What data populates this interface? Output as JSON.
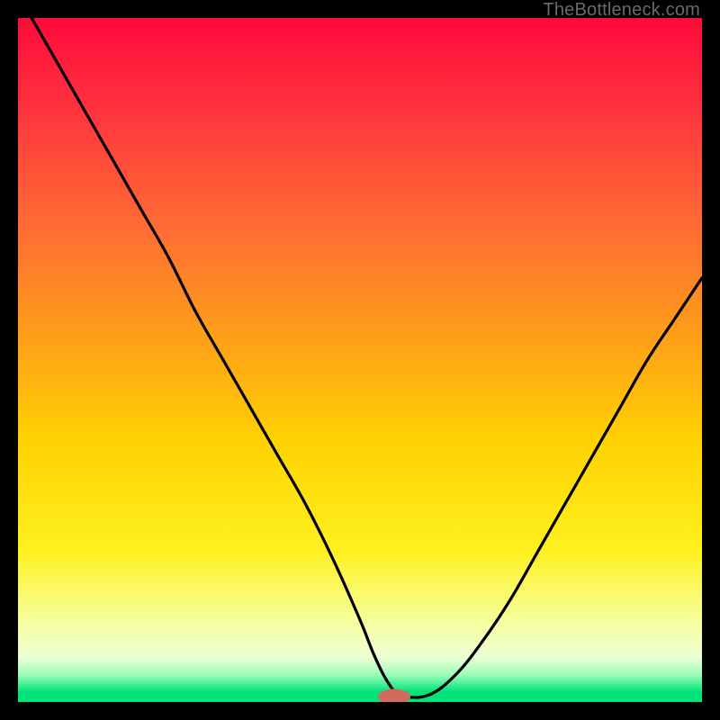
{
  "watermark": "TheBottleneck.com",
  "chart_data": {
    "type": "line",
    "title": "",
    "xlabel": "",
    "ylabel": "",
    "xlim": [
      0,
      100
    ],
    "ylim": [
      0,
      100
    ],
    "grid": false,
    "legend": false,
    "gradient_stops": [
      {
        "offset": 0.0,
        "color": "#ff0a3a"
      },
      {
        "offset": 0.12,
        "color": "#ff2f3e"
      },
      {
        "offset": 0.3,
        "color": "#ff6a34"
      },
      {
        "offset": 0.48,
        "color": "#ffa316"
      },
      {
        "offset": 0.62,
        "color": "#ffd201"
      },
      {
        "offset": 0.78,
        "color": "#fff120"
      },
      {
        "offset": 0.88,
        "color": "#f6ff9b"
      },
      {
        "offset": 0.935,
        "color": "#ecffd6"
      },
      {
        "offset": 0.96,
        "color": "#9dfdb8"
      },
      {
        "offset": 0.985,
        "color": "#00e47a"
      },
      {
        "offset": 1.0,
        "color": "#00e47a"
      }
    ],
    "series": [
      {
        "name": "bottleneck-curve",
        "x": [
          2,
          6,
          10,
          14,
          18,
          22,
          26,
          30,
          34,
          38,
          42,
          46,
          50,
          52,
          54,
          56,
          60,
          64,
          68,
          72,
          76,
          80,
          84,
          88,
          92,
          96,
          100
        ],
        "y": [
          100,
          93,
          86,
          79,
          72,
          65,
          57,
          50,
          43,
          36,
          29,
          21,
          12,
          7,
          3,
          1,
          1,
          4,
          9,
          15,
          22,
          29,
          36,
          43,
          50,
          56,
          62
        ]
      }
    ],
    "marker": {
      "x": 55,
      "y": 0.8,
      "color": "#d46a5f",
      "rx": 2.4,
      "ry": 1.1
    }
  }
}
